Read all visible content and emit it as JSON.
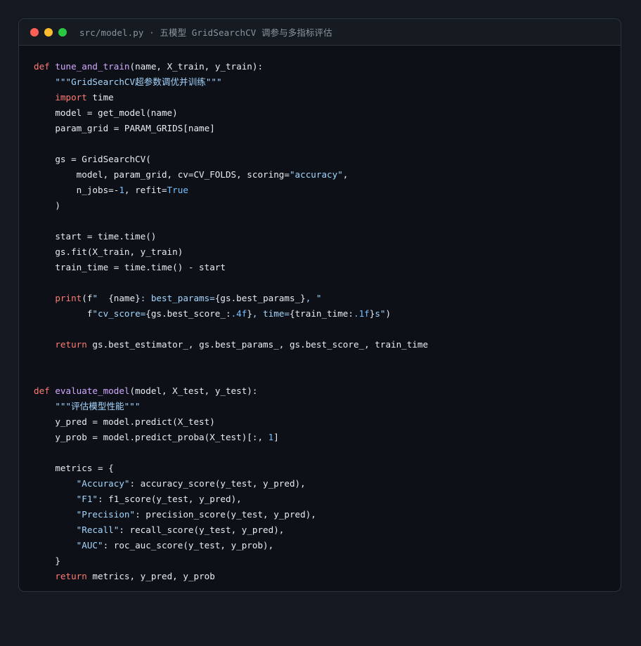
{
  "window": {
    "title": "src/model.py · 五模型 GridSearchCV 调参与多指标评估",
    "controls": {
      "close": "#ff5f57",
      "minimize": "#febc2e",
      "maximize": "#28c840"
    }
  },
  "colors": {
    "background": "#141821",
    "editor_bg": "#0d1117",
    "titlebar_bg": "#161b22",
    "keyword": "#ff7b72",
    "function": "#d2a8ff",
    "string": "#a5d6ff",
    "number": "#79c0ff",
    "text": "#e6edf3"
  },
  "code_lines": [
    [
      [
        "kw",
        "def"
      ],
      [
        "plain",
        " "
      ],
      [
        "fn",
        "tune_and_train"
      ],
      [
        "plain",
        "(name, X_train, y_train):"
      ]
    ],
    [
      [
        "plain",
        "    "
      ],
      [
        "str",
        "\"\"\"GridSearchCV超参数调优并训练\"\"\""
      ]
    ],
    [
      [
        "plain",
        "    "
      ],
      [
        "kw",
        "import"
      ],
      [
        "plain",
        " time"
      ]
    ],
    [
      [
        "plain",
        "    model = get_model(name)"
      ]
    ],
    [
      [
        "plain",
        "    param_grid = PARAM_GRIDS[name]"
      ]
    ],
    [],
    [
      [
        "plain",
        "    gs = GridSearchCV("
      ]
    ],
    [
      [
        "plain",
        "        model, param_grid, cv=CV_FOLDS, scoring="
      ],
      [
        "str",
        "\"accuracy\""
      ],
      [
        "plain",
        ","
      ]
    ],
    [
      [
        "plain",
        "        n_jobs=-"
      ],
      [
        "num",
        "1"
      ],
      [
        "plain",
        ", refit="
      ],
      [
        "const",
        "True"
      ]
    ],
    [
      [
        "plain",
        "    )"
      ]
    ],
    [],
    [
      [
        "plain",
        "    start = time.time()"
      ]
    ],
    [
      [
        "plain",
        "    gs.fit(X_train, y_train)"
      ]
    ],
    [
      [
        "plain",
        "    train_time = time.time() - start"
      ]
    ],
    [],
    [
      [
        "plain",
        "    "
      ],
      [
        "kw",
        "print"
      ],
      [
        "plain",
        "(f"
      ],
      [
        "str",
        "\"  "
      ],
      [
        "plain",
        "{name}"
      ],
      [
        "str",
        ": best_params="
      ],
      [
        "plain",
        "{gs.best_params_}"
      ],
      [
        "str",
        ", \""
      ]
    ],
    [
      [
        "plain",
        "          f"
      ],
      [
        "str",
        "\"cv_score="
      ],
      [
        "plain",
        "{gs.best_score_:"
      ],
      [
        "num",
        ".4f"
      ],
      [
        "plain",
        "}"
      ],
      [
        "str",
        ", time="
      ],
      [
        "plain",
        "{train_time:"
      ],
      [
        "num",
        ".1f"
      ],
      [
        "plain",
        "}"
      ],
      [
        "str",
        "s\""
      ],
      [
        "plain",
        ")"
      ]
    ],
    [],
    [
      [
        "plain",
        "    "
      ],
      [
        "kw",
        "return"
      ],
      [
        "plain",
        " gs.best_estimator_, gs.best_params_, gs.best_score_, train_time"
      ]
    ],
    [],
    [],
    [
      [
        "kw",
        "def"
      ],
      [
        "plain",
        " "
      ],
      [
        "fn",
        "evaluate_model"
      ],
      [
        "plain",
        "(model, X_test, y_test):"
      ]
    ],
    [
      [
        "plain",
        "    "
      ],
      [
        "str",
        "\"\"\"评估模型性能\"\"\""
      ]
    ],
    [
      [
        "plain",
        "    y_pred = model.predict(X_test)"
      ]
    ],
    [
      [
        "plain",
        "    y_prob = model.predict_proba(X_test)[:, "
      ],
      [
        "num",
        "1"
      ],
      [
        "plain",
        "]"
      ]
    ],
    [],
    [
      [
        "plain",
        "    metrics = {"
      ]
    ],
    [
      [
        "plain",
        "        "
      ],
      [
        "str",
        "\"Accuracy\""
      ],
      [
        "plain",
        ": accuracy_score(y_test, y_pred),"
      ]
    ],
    [
      [
        "plain",
        "        "
      ],
      [
        "str",
        "\"F1\""
      ],
      [
        "plain",
        ": f1_score(y_test, y_pred),"
      ]
    ],
    [
      [
        "plain",
        "        "
      ],
      [
        "str",
        "\"Precision\""
      ],
      [
        "plain",
        ": precision_score(y_test, y_pred),"
      ]
    ],
    [
      [
        "plain",
        "        "
      ],
      [
        "str",
        "\"Recall\""
      ],
      [
        "plain",
        ": recall_score(y_test, y_pred),"
      ]
    ],
    [
      [
        "plain",
        "        "
      ],
      [
        "str",
        "\"AUC\""
      ],
      [
        "plain",
        ": roc_auc_score(y_test, y_prob),"
      ]
    ],
    [
      [
        "plain",
        "    }"
      ]
    ],
    [
      [
        "plain",
        "    "
      ],
      [
        "kw",
        "return"
      ],
      [
        "plain",
        " metrics, y_pred, y_prob"
      ]
    ]
  ]
}
